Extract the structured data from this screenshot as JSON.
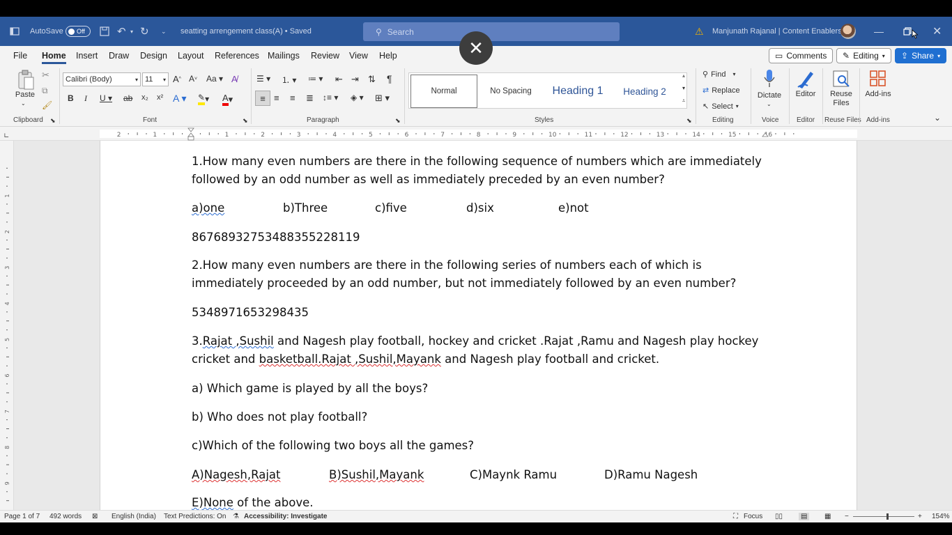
{
  "titlebar": {
    "autosave_label": "AutoSave",
    "autosave_state": "Off",
    "doc_title": "seatting arrengement class(A) • Saved",
    "search_placeholder": "Search",
    "user": "Manjunath Rajanal | Content Enablers"
  },
  "menu": {
    "tabs": [
      "File",
      "Home",
      "Insert",
      "Draw",
      "Design",
      "Layout",
      "References",
      "Mailings",
      "Review",
      "View",
      "Help"
    ],
    "active": "Home",
    "comments_label": "Comments",
    "editing_label": "Editing",
    "share_label": "Share"
  },
  "ribbon": {
    "clipboard": {
      "paste": "Paste",
      "label": "Clipboard"
    },
    "font": {
      "name": "Calibri (Body)",
      "size": "11",
      "label": "Font"
    },
    "paragraph": {
      "label": "Paragraph"
    },
    "styles": {
      "items": [
        "Normal",
        "No Spacing",
        "Heading 1",
        "Heading 2"
      ],
      "label": "Styles"
    },
    "editing": {
      "find": "Find",
      "replace": "Replace",
      "select": "Select",
      "label": "Editing"
    },
    "voice": {
      "dictate": "Dictate",
      "label": "Voice"
    },
    "editor": {
      "name": "Editor",
      "label": "Editor"
    },
    "reuse": {
      "name": "Reuse Files",
      "label": "Reuse Files"
    },
    "addins": {
      "name": "Add-ins",
      "label": "Add-ins"
    }
  },
  "document": {
    "q1_line1": "1.How many even numbers are there in the following sequence of numbers which are immediately",
    "q1_line2": "followed by an odd number as well as immediately preceded by an even number?",
    "q1_options": [
      "a)one",
      "b)Three",
      "c)five",
      "d)six",
      "e)not"
    ],
    "q1_sequence": "86768932753488355228119",
    "q2_line1": "2.How many even numbers are there in the following series of numbers each of which is",
    "q2_line2": "immediately proceeded by an odd number, but not immediately followed by an even number?",
    "q2_sequence": "5348971653298435",
    "q3_line1_parts": [
      "3.",
      "Rajat ,Sushil",
      " and Nagesh play football, hockey and cricket .Rajat ,Ramu and Nagesh play hockey"
    ],
    "q3_line2_parts": [
      "cricket and ",
      "basketball.Rajat ,Sushil,Mayank",
      " and Nagesh play football and cricket."
    ],
    "qa": "a) Which game is played by all the boys?",
    "qb": "b) Who does not play football?",
    "qc": "c)Which of the following two boys all the games?",
    "qc_options": [
      "A)Nagesh,Rajat",
      "B)Sushil,Mayank",
      "C)Maynk Ramu",
      "D)Ramu Nagesh"
    ],
    "qc_last_parts": [
      "E)None",
      " of the above."
    ]
  },
  "status": {
    "page": "Page 1 of 7",
    "words": "492 words",
    "language": "English (India)",
    "predictions": "Text Predictions: On",
    "accessibility": "Accessibility: Investigate",
    "focus": "Focus",
    "zoom": "154%"
  },
  "colors": {
    "brand": "#2b579a",
    "share": "#1f6fd1"
  }
}
